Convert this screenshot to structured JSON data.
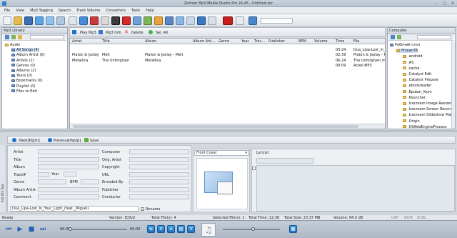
{
  "window": {
    "title": "Zortam Mp3 Media Studio Pro 24.45 - Untitled.zor"
  },
  "menu": [
    "File",
    "View",
    "Mp3 Tagging",
    "Search",
    "Track Volume",
    "Converters",
    "Tools",
    "Help"
  ],
  "library_panel": {
    "title": "Mp3 Library"
  },
  "library_tree": [
    {
      "label": "Audio",
      "level": 0
    },
    {
      "label": "All Songs (4)",
      "level": 1,
      "selected": true
    },
    {
      "label": "Album Artist (0)",
      "level": 1
    },
    {
      "label": "Artists (2)",
      "level": 1
    },
    {
      "label": "Genres (0)",
      "level": 1
    },
    {
      "label": "Albums (2)",
      "level": 1
    },
    {
      "label": "Years (0)",
      "level": 1
    },
    {
      "label": "Bookmarks (0)",
      "level": 1
    },
    {
      "label": "Playlist (0)",
      "level": 1
    },
    {
      "label": "Files to Edit",
      "level": 1
    }
  ],
  "action_bar": {
    "play": "Play Mp3",
    "info": "Mp3 Info",
    "delete": "Delete",
    "select_all": "Sel. All"
  },
  "track_columns": [
    "Artist",
    "Title",
    "Album",
    "Album Arti...",
    "Genre",
    "Year",
    "Trac...",
    "Publisher",
    "BPM",
    "Volume",
    "Time",
    "File"
  ],
  "tracks": [
    {
      "artist": "",
      "title": "",
      "album": "",
      "time": "03:24",
      "file": "Dua_Lipa-Lost_In_Y..."
    },
    {
      "artist": "Platon & Joolay",
      "title": "Melt",
      "album": "Platon & Joolay - Melt",
      "time": "02:39",
      "file": "Platon & Joolay - M..."
    },
    {
      "artist": "Metallica",
      "title": "The Unforgiven",
      "album": "Metallica",
      "time": "06:24",
      "file": "The Unforgiven.mp3"
    },
    {
      "artist": "",
      "title": "",
      "album": "",
      "time": "00:09",
      "file": "Ácóél.MP3"
    }
  ],
  "computer_panel": {
    "title": "Computer"
  },
  "computer_tree": [
    {
      "label": "Рабочий стол",
      "level": 0
    },
    {
      "label": "finlyan76",
      "level": 1,
      "selected": true
    },
    {
      "label": ".android",
      "level": 2
    },
    {
      "label": ".AS",
      "level": 2
    },
    {
      "label": ".cache",
      "level": 2
    },
    {
      "label": ".Catalyst Edit",
      "level": 2
    },
    {
      "label": ".Catalyst Prepare",
      "level": 2
    },
    {
      "label": ".ebookreader",
      "level": 2
    },
    {
      "label": ".Epubor_Keys",
      "level": 2
    },
    {
      "label": ".fwuncher",
      "level": 2
    },
    {
      "label": ".Icecream Image Resizer",
      "level": 2
    },
    {
      "label": ".Icecream Screen Recorde",
      "level": 2
    },
    {
      "label": ".Icecream Slideshow Make",
      "level": 2
    },
    {
      "label": ".Origin",
      "level": 2
    },
    {
      "label": ".QtWebEngineProcess",
      "level": 2
    }
  ],
  "editor_nav": {
    "next": "Next[PgDn]",
    "previous": "Previous[PgUp]",
    "save": "Save"
  },
  "side_tab": "Edit ID3 Tags",
  "left_fields": [
    "Artist",
    "Title",
    "Album",
    "Track#",
    "Genre",
    "Album Artist",
    "Comment"
  ],
  "year_label": "Year",
  "bpm_label": "BPM",
  "right_fields": [
    "Composer",
    "Orig. Artist",
    "Copyright",
    "URL",
    "Encoded By",
    "Publisher",
    "Conductor"
  ],
  "cover": {
    "selected": "Front Cover"
  },
  "lyricist_label": "Lyricist",
  "filename_value": "Dua_Lipa-Lost_In_Your_Light_(feat._Miguel)",
  "rename_label": "Rename",
  "status": {
    "ready": "Ready",
    "version": "Version: ID3v2",
    "total_files": "Total File(s): 4",
    "selected": "Selected File(s): 1",
    "total_time": "Total Time: 12:36",
    "total_size": "Total Size: 23.37 MB",
    "volume": "Volume: 94.5 dB",
    "indicators": [
      "CAP",
      "NUM",
      "SCRL"
    ]
  },
  "player": {
    "time_start": "00:00",
    "time_end": "00:00"
  },
  "colors": {
    "accent": "#1f6fc4",
    "toolbar_bg": "#e3e8ee",
    "selection": "#cde0f6"
  }
}
